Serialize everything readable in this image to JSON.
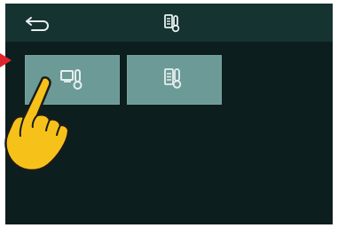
{
  "topbar": {
    "back_icon": "back-arrow-icon",
    "title_icon": "thermostat-settings-icon"
  },
  "tiles": [
    {
      "icon": "screen-thermostat-icon",
      "state": "pressed"
    },
    {
      "icon": "thermostat-settings-icon",
      "state": "idle"
    }
  ],
  "overlay": {
    "hand_icon": "pointing-hand-icon",
    "arrow_icon": "red-pointer-arrow-icon"
  },
  "colors": {
    "screen_bg": "#0c1e1d",
    "topbar_bg": "#153331",
    "tile_bg": "#6c9a97",
    "icon_fg": "#e6efee",
    "hand_fill": "#f6c21a",
    "arrow": "#e0242c"
  }
}
